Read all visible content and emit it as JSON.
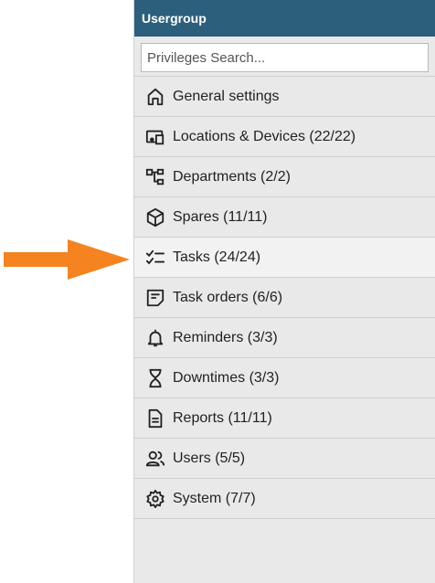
{
  "panel": {
    "title": "Usergroup"
  },
  "search": {
    "placeholder": "Privileges Search..."
  },
  "menu": {
    "items": [
      {
        "label": "General settings",
        "icon": "home-icon"
      },
      {
        "label": "Locations & Devices (22/22)",
        "icon": "devices-icon"
      },
      {
        "label": "Departments (2/2)",
        "icon": "hierarchy-icon"
      },
      {
        "label": "Spares (11/11)",
        "icon": "box-icon"
      },
      {
        "label": "Tasks (24/24)",
        "icon": "checklist-icon"
      },
      {
        "label": "Task orders (6/6)",
        "icon": "note-icon"
      },
      {
        "label": "Reminders (3/3)",
        "icon": "bell-icon"
      },
      {
        "label": "Downtimes (3/3)",
        "icon": "hourglass-icon"
      },
      {
        "label": "Reports (11/11)",
        "icon": "report-icon"
      },
      {
        "label": "Users (5/5)",
        "icon": "users-icon"
      },
      {
        "label": "System (7/7)",
        "icon": "gear-icon"
      }
    ]
  },
  "colors": {
    "header": "#2c5f7c",
    "panel": "#e9e9e9",
    "arrow": "#f5831f"
  }
}
